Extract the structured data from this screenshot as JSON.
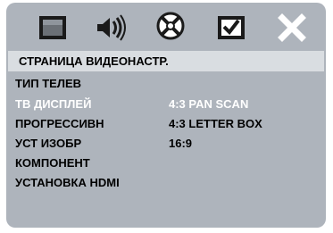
{
  "tabs": [
    {
      "icon": "tv-screen-icon"
    },
    {
      "icon": "speaker-sound-icon"
    },
    {
      "icon": "disc-settings-icon",
      "active": true
    },
    {
      "icon": "preference-check-icon"
    },
    {
      "icon": "close-icon"
    }
  ],
  "header": {
    "title": "СТРАНИЦА ВИДЕОНАСТР."
  },
  "menu": {
    "items": [
      {
        "label": "ТИП ТЕЛЕВ"
      },
      {
        "label": "ТВ ДИСПЛЕЙ",
        "selected": true
      },
      {
        "label": "ПРОГРЕССИВН"
      },
      {
        "label": "УСТ ИЗОБР"
      },
      {
        "label": "КОМПОНЕНТ"
      },
      {
        "label": "УСТАНОВКА HDMI"
      }
    ]
  },
  "options": {
    "items": [
      {
        "label": "4:3 PAN SCAN",
        "highlighted": true
      },
      {
        "label": "4:3 LETTER BOX"
      },
      {
        "label": "16:9"
      }
    ]
  },
  "colors": {
    "screen_bg": "#aeb4bc",
    "header_bg": "#d9dde1",
    "selected_text": "#ffffff",
    "normal_text": "#000000"
  }
}
